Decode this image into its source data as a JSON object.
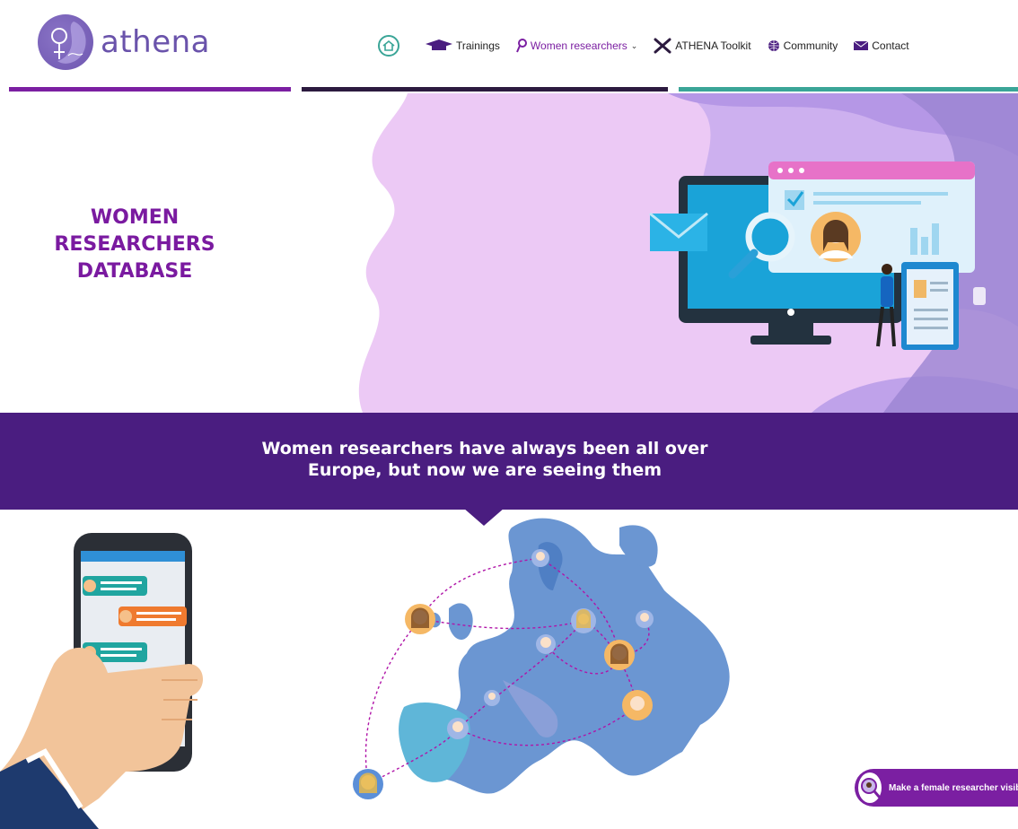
{
  "brand": {
    "name": "athena"
  },
  "nav": {
    "home_icon": "home-icon",
    "items": [
      {
        "label": "Trainings",
        "icon": "graduation-cap-icon"
      },
      {
        "label": "Women researchers",
        "icon": "female-symbol-icon",
        "active": true
      },
      {
        "label": "ATHENA Toolkit",
        "icon": "tools-icon"
      },
      {
        "label": "Community",
        "icon": "globe-icon"
      },
      {
        "label": "Contact",
        "icon": "envelope-icon"
      }
    ]
  },
  "hero": {
    "title_lines": [
      "WOMEN",
      "RESEARCHERS",
      "DATABASE"
    ]
  },
  "band": {
    "lines": [
      "Women researchers have always been all over",
      "Europe, but now we are seeing them"
    ]
  },
  "cta": {
    "label": "Make a female researcher visible"
  },
  "colors": {
    "purple": "#7b1fa2",
    "dark": "#2c1a3f",
    "teal": "#3aa597",
    "band": "#4a1d80",
    "lilac": "#d9b8f0"
  }
}
